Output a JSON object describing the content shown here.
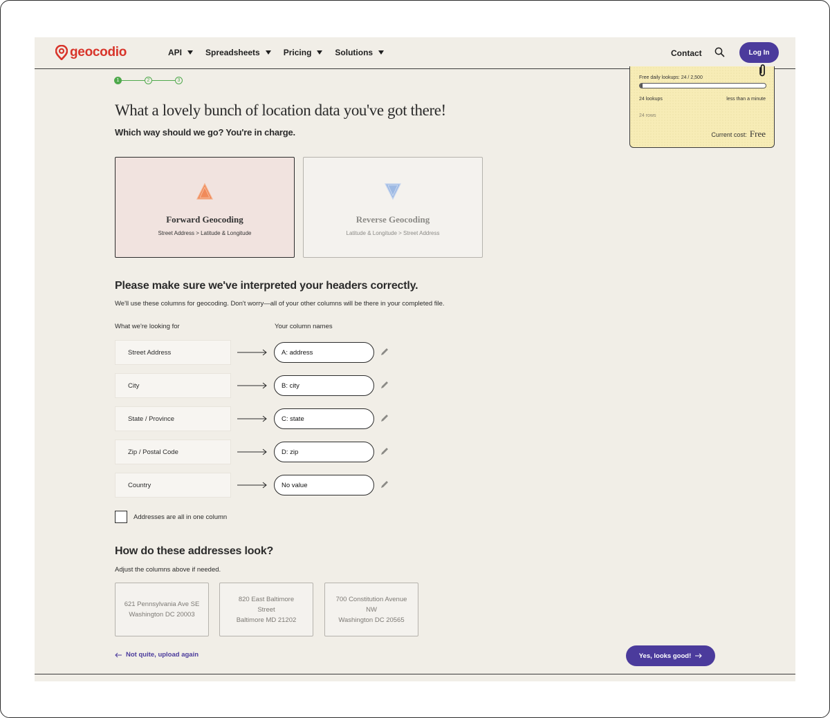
{
  "nav": {
    "logo_text": "geocodio",
    "items": [
      {
        "label": "API"
      },
      {
        "label": "Spreadsheets"
      },
      {
        "label": "Pricing"
      },
      {
        "label": "Solutions"
      }
    ],
    "contact": "Contact",
    "login": "Log In"
  },
  "steps": [
    "1",
    "2",
    "3"
  ],
  "usage": {
    "title": "Free daily lookups: 24 / 2,500",
    "progress_fraction": 0.0096,
    "lookups": "24 lookups",
    "time": "less than a minute",
    "rows": "24 rows",
    "cost_label": "Current cost:",
    "cost_value": "Free"
  },
  "heading": "What a lovely bunch of location data you've got there!",
  "subheading": "Which way should we go? You're in charge.",
  "modes": {
    "forward": {
      "title": "Forward Geocoding",
      "desc": "Street Address > Latitude & Longitude"
    },
    "reverse": {
      "title": "Reverse Geocoding",
      "desc": "Latitude & Longitude > Street Address"
    }
  },
  "headers_section": {
    "title": "Please make sure we've interpreted your headers correctly.",
    "desc": "We'll use these columns for geocoding. Don't worry—all of your other columns will be there in your completed file.",
    "left_head": "What we're looking for",
    "right_head": "Your column names",
    "rows": [
      {
        "field": "Street Address",
        "column": "A: address"
      },
      {
        "field": "City",
        "column": "B: city"
      },
      {
        "field": "State / Province",
        "column": "C: state"
      },
      {
        "field": "Zip / Postal Code",
        "column": "D: zip"
      },
      {
        "field": "Country",
        "column": "No value"
      }
    ],
    "checkbox_label": "Addresses are all in one column"
  },
  "preview": {
    "title": "How do these addresses look?",
    "desc": "Adjust the columns above if needed.",
    "samples": [
      {
        "lines": [
          "621 Pennsylvania Ave SE",
          "Washington DC 20003"
        ]
      },
      {
        "lines": [
          "820 East Baltimore",
          "Street",
          "Baltimore MD 21202"
        ]
      },
      {
        "lines": [
          "700 Constitution Avenue",
          "NW",
          "Washington DC 20565"
        ]
      }
    ]
  },
  "actions": {
    "back": "Not quite, upload again",
    "confirm": "Yes, looks good!"
  },
  "colors": {
    "brand_red": "#d8342a",
    "brand_purple": "#4b3b9c",
    "step_green": "#4fa94c",
    "page_bg": "#f1eee7"
  }
}
